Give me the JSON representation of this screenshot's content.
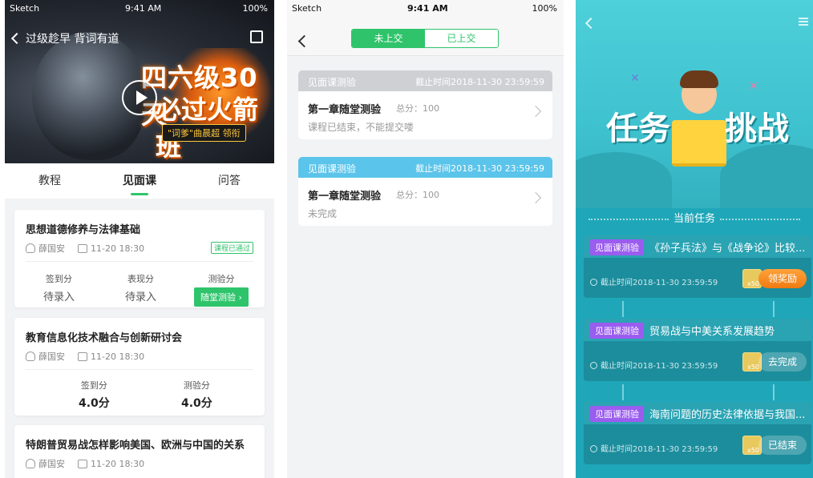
{
  "screen1": {
    "status": {
      "carrier": "Sketch",
      "time": "9:41 AM",
      "battery": "100%"
    },
    "nav_title": "过级趁早 背词有道",
    "banner": {
      "line1": "四六级30天",
      "line2": "必过火箭班",
      "tagline": "\"词爹\"曲晨超 领衔"
    },
    "tabs": [
      "教程",
      "见面课",
      "问答"
    ],
    "courses": [
      {
        "title": "思想道德修养与法律基础",
        "teacher": "薛国安",
        "date": "11-20 18:30",
        "stamp": "课程已通过",
        "stats": [
          {
            "label": "签到分",
            "value": "待录入"
          },
          {
            "label": "表现分",
            "value": "待录入"
          },
          {
            "label": "测验分",
            "button": "随堂测验 ›"
          }
        ]
      },
      {
        "title": "教育信息化技术融合与创新研讨会",
        "teacher": "薛国安",
        "date": "11-20 18:30",
        "stats": [
          {
            "label": "签到分",
            "value": "4.0分"
          },
          {
            "label": "测验分",
            "value": "4.0分"
          }
        ]
      },
      {
        "title": "特朗普贸易战怎样影响美国、欧洲与中国的关系",
        "teacher": "薛国安",
        "date": "11-20 18:30"
      }
    ]
  },
  "screen2": {
    "status": {
      "carrier": "Sketch",
      "time": "9:41 AM",
      "battery": "100%"
    },
    "segments": [
      "未上交",
      "已上交"
    ],
    "items": [
      {
        "head": "见面课测验",
        "deadline": "截止时间2018-11-30 23:59:59",
        "name": "第一章随堂测验",
        "score": "总分：100",
        "state": "课程已结束，不能提交喽",
        "head_color": "#cfd0d3"
      },
      {
        "head": "见面课测验",
        "deadline": "截止时间2018-11-30 23:59:59",
        "name": "第一章随堂测验",
        "score": "总分：100",
        "state": "未完成",
        "head_color": "#5bc4ea"
      }
    ]
  },
  "screen3": {
    "title_left": "任务",
    "title_right": "挑战",
    "section": "当前任务",
    "tasks": [
      {
        "tag": "见面课测验",
        "title": "《孙子兵法》与《战争论》比较...",
        "deadline": "截止时间2018-11-30 23:59:59",
        "coin": "x50",
        "action": "领奖励",
        "style": "orange"
      },
      {
        "tag": "见面课测验",
        "title": "贸易战与中美关系发展趋势",
        "deadline": "截止时间2018-11-30 23:59:59",
        "coin": "x50",
        "action": "去完成",
        "style": "gray"
      },
      {
        "tag": "见面课测验",
        "title": "海南问题的历史法律依据与我国...",
        "deadline": "截止时间2018-11-30 23:59:59",
        "coin": "x50",
        "action": "已结束",
        "style": "gray"
      }
    ]
  }
}
